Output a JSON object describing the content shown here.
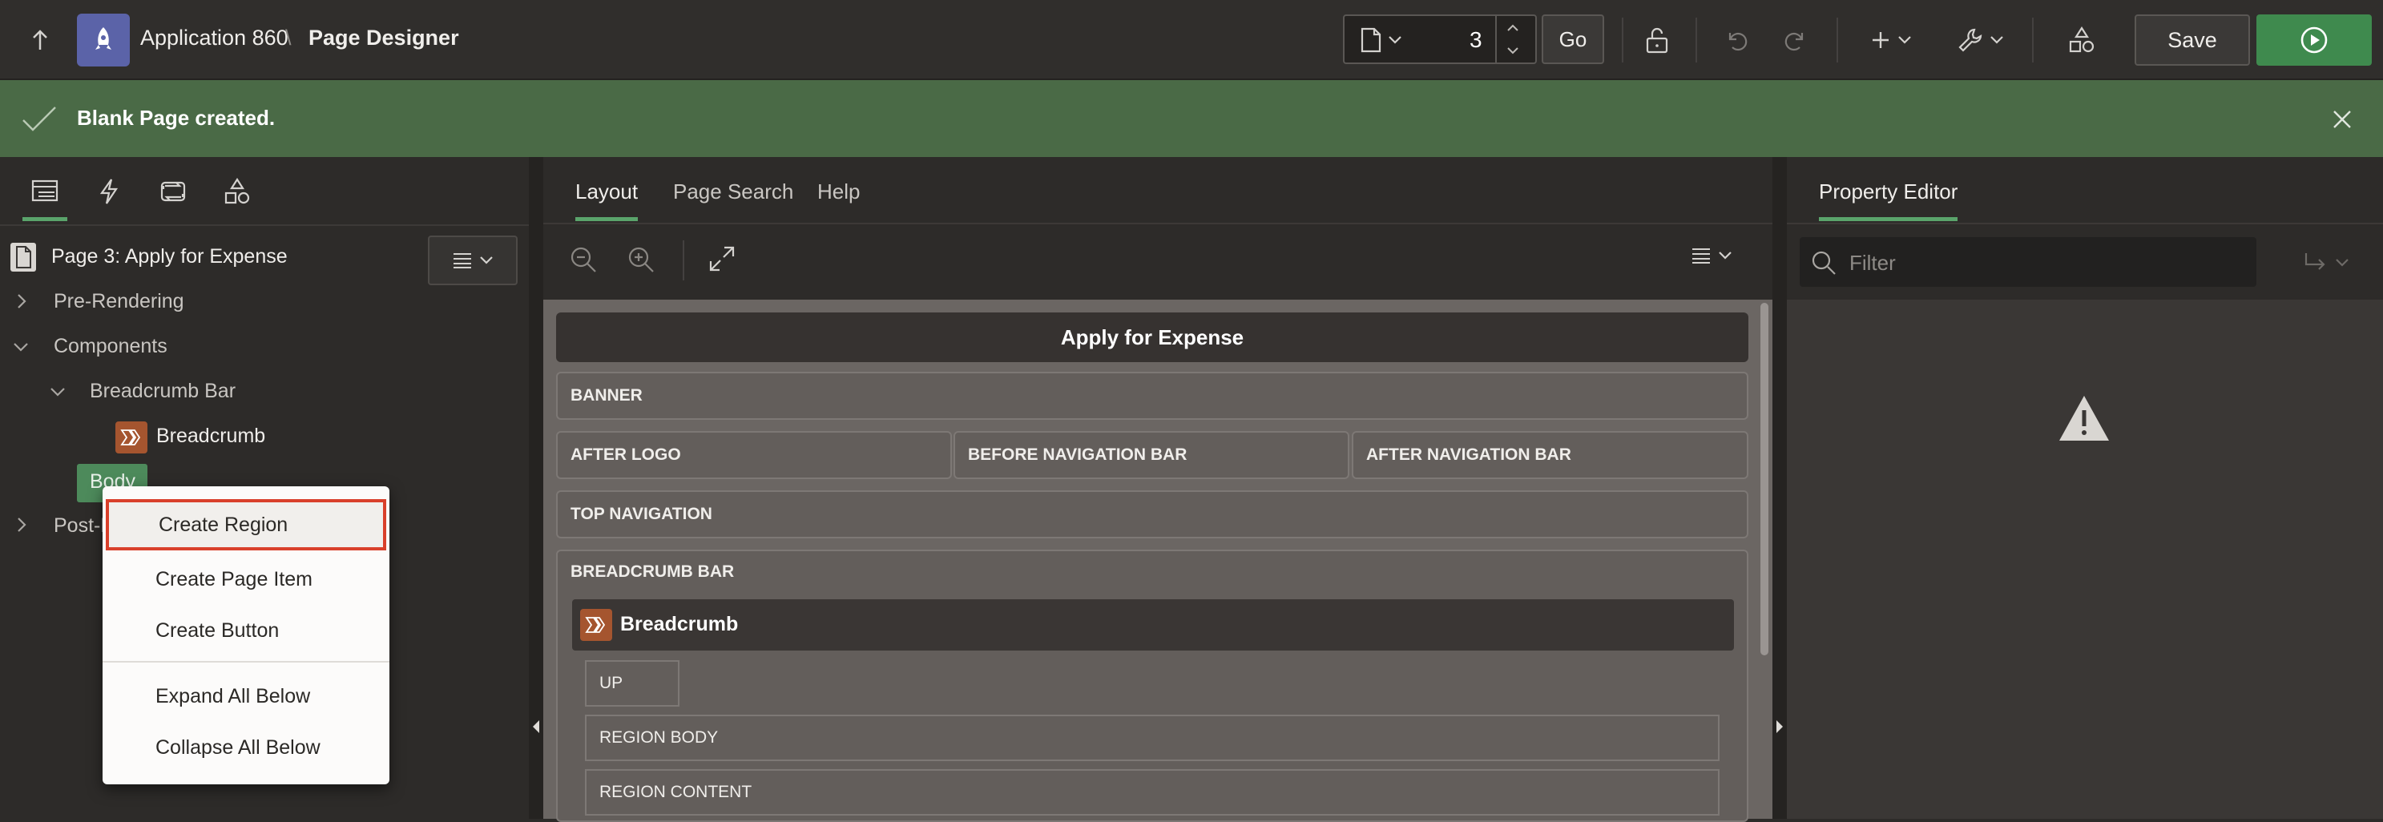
{
  "header": {
    "app_name": "Application 860",
    "separator": "\\",
    "page_title": "Page Designer",
    "page_number": "3",
    "go_label": "Go",
    "save_label": "Save"
  },
  "notification": {
    "message": "Blank Page created."
  },
  "left_pane": {
    "page_label": "Page 3: Apply for Expense",
    "tree": {
      "pre_rendering": "Pre-Rendering",
      "components": "Components",
      "breadcrumb_bar": "Breadcrumb Bar",
      "breadcrumb": "Breadcrumb",
      "body": "Body",
      "post_rendering": "Post-R"
    }
  },
  "context_menu": {
    "items": [
      "Create Region",
      "Create Page Item",
      "Create Button",
      "Expand All Below",
      "Collapse All Below"
    ]
  },
  "center_pane": {
    "tabs": [
      "Layout",
      "Page Search",
      "Help"
    ],
    "layout": {
      "page_title": "Apply for Expense",
      "banner": "BANNER",
      "after_logo": "AFTER LOGO",
      "before_nav": "BEFORE NAVIGATION BAR",
      "after_nav": "AFTER NAVIGATION BAR",
      "top_nav": "TOP NAVIGATION",
      "breadcrumb_bar": "BREADCRUMB BAR",
      "breadcrumb_region": "Breadcrumb",
      "up": "UP",
      "region_body": "REGION BODY",
      "region_content": "REGION CONTENT"
    }
  },
  "right_pane": {
    "tab": "Property Editor",
    "filter_placeholder": "Filter"
  },
  "colors": {
    "accent_green": "#5aa46b",
    "run_button": "#3f8a4e",
    "notification_bg": "#4a6a46",
    "highlight_border": "#d9402b",
    "app_icon_bg": "#5b63a8",
    "breadcrumb_icon_bg": "#a5552f"
  }
}
